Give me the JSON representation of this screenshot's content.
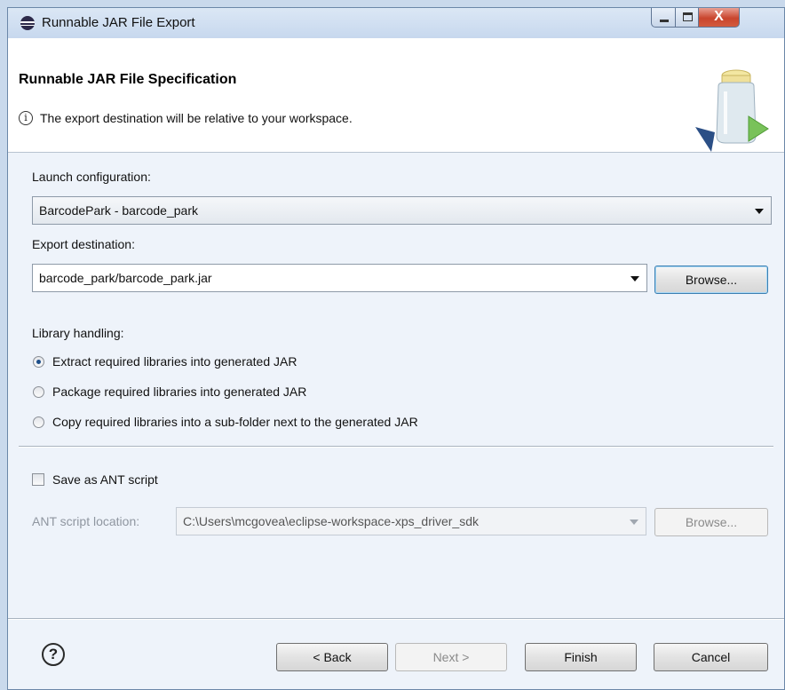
{
  "window": {
    "title": "Runnable JAR File Export",
    "controls": {
      "minimize": "minimize",
      "maximize": "maximize",
      "close": "X"
    }
  },
  "header": {
    "title": "Runnable JAR File Specification",
    "message": "The export destination will be relative to your workspace.",
    "info_icon": "i"
  },
  "launch": {
    "label": "Launch configuration:",
    "value": "BarcodePark - barcode_park"
  },
  "export": {
    "label": "Export destination:",
    "value": "barcode_park/barcode_park.jar",
    "browse_label": "Browse..."
  },
  "library": {
    "label": "Library handling:",
    "options": [
      {
        "label": "Extract required libraries into generated JAR",
        "selected": true
      },
      {
        "label": "Package required libraries into generated JAR",
        "selected": false
      },
      {
        "label": "Copy required libraries into a sub-folder next to the generated JAR",
        "selected": false
      }
    ]
  },
  "ant": {
    "checkbox_label": "Save as ANT script",
    "checked": false,
    "location_label": "ANT script location:",
    "location_value": "C:\\Users\\mcgovea\\eclipse-workspace-xps_driver_sdk",
    "browse_label": "Browse..."
  },
  "footer": {
    "help_icon": "?",
    "back_label": "< Back",
    "next_label": "Next >",
    "finish_label": "Finish",
    "cancel_label": "Cancel"
  }
}
